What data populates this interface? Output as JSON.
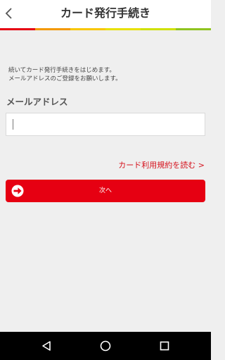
{
  "header": {
    "title": "カード発行手続き",
    "back_icon": "chevron-left-icon",
    "stripe_colors": [
      "#e60012",
      "#f39800",
      "#f8c600",
      "#e8e000",
      "#cfe000",
      "#8fc31f"
    ]
  },
  "main": {
    "intro_line1": "続いてカード発行手続きをはじめます。",
    "intro_line2": "メールアドレスのご登録をお願いします。",
    "email_label": "メールアドレス",
    "email_value": "",
    "terms_link": "カード利用規約を読む >",
    "next_button": "次へ",
    "next_icon": "arrow-right-circle-icon"
  },
  "navbar": {
    "back_icon": "triangle-back-icon",
    "home_icon": "circle-home-icon",
    "recents_icon": "square-recents-icon"
  },
  "colors": {
    "accent": "#e60012",
    "link": "#d5101b",
    "background": "#efefef"
  }
}
